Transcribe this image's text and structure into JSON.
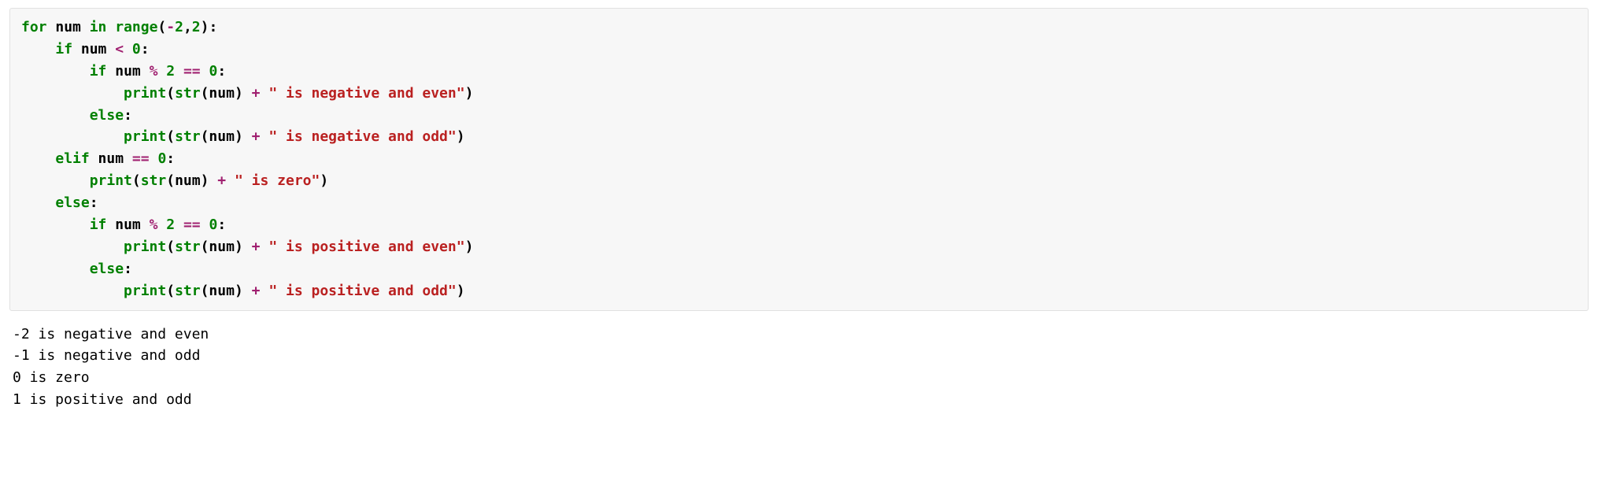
{
  "code": {
    "lines": [
      [
        {
          "cls": "k",
          "t": "for"
        },
        {
          "cls": "n",
          "t": " num "
        },
        {
          "cls": "k",
          "t": "in"
        },
        {
          "cls": "n",
          "t": " "
        },
        {
          "cls": "nb",
          "t": "range"
        },
        {
          "cls": "p",
          "t": "("
        },
        {
          "cls": "o",
          "t": "-"
        },
        {
          "cls": "mi",
          "t": "2"
        },
        {
          "cls": "p",
          "t": ","
        },
        {
          "cls": "mi",
          "t": "2"
        },
        {
          "cls": "p",
          "t": "):"
        }
      ],
      [
        {
          "cls": "n",
          "t": "    "
        },
        {
          "cls": "k",
          "t": "if"
        },
        {
          "cls": "n",
          "t": " num "
        },
        {
          "cls": "o",
          "t": "<"
        },
        {
          "cls": "n",
          "t": " "
        },
        {
          "cls": "mi",
          "t": "0"
        },
        {
          "cls": "p",
          "t": ":"
        }
      ],
      [
        {
          "cls": "n",
          "t": "        "
        },
        {
          "cls": "k",
          "t": "if"
        },
        {
          "cls": "n",
          "t": " num "
        },
        {
          "cls": "o",
          "t": "%"
        },
        {
          "cls": "n",
          "t": " "
        },
        {
          "cls": "mi",
          "t": "2"
        },
        {
          "cls": "n",
          "t": " "
        },
        {
          "cls": "o",
          "t": "=="
        },
        {
          "cls": "n",
          "t": " "
        },
        {
          "cls": "mi",
          "t": "0"
        },
        {
          "cls": "p",
          "t": ":"
        }
      ],
      [
        {
          "cls": "n",
          "t": "            "
        },
        {
          "cls": "nb",
          "t": "print"
        },
        {
          "cls": "p",
          "t": "("
        },
        {
          "cls": "nb",
          "t": "str"
        },
        {
          "cls": "p",
          "t": "(num) "
        },
        {
          "cls": "o",
          "t": "+"
        },
        {
          "cls": "p",
          "t": " "
        },
        {
          "cls": "s",
          "t": "\" is negative and even\""
        },
        {
          "cls": "p",
          "t": ")"
        }
      ],
      [
        {
          "cls": "n",
          "t": "        "
        },
        {
          "cls": "k",
          "t": "else"
        },
        {
          "cls": "p",
          "t": ":"
        }
      ],
      [
        {
          "cls": "n",
          "t": "            "
        },
        {
          "cls": "nb",
          "t": "print"
        },
        {
          "cls": "p",
          "t": "("
        },
        {
          "cls": "nb",
          "t": "str"
        },
        {
          "cls": "p",
          "t": "(num) "
        },
        {
          "cls": "o",
          "t": "+"
        },
        {
          "cls": "p",
          "t": " "
        },
        {
          "cls": "s",
          "t": "\" is negative and odd\""
        },
        {
          "cls": "p",
          "t": ")"
        }
      ],
      [
        {
          "cls": "n",
          "t": "    "
        },
        {
          "cls": "k",
          "t": "elif"
        },
        {
          "cls": "n",
          "t": " num "
        },
        {
          "cls": "o",
          "t": "=="
        },
        {
          "cls": "n",
          "t": " "
        },
        {
          "cls": "mi",
          "t": "0"
        },
        {
          "cls": "p",
          "t": ":"
        }
      ],
      [
        {
          "cls": "n",
          "t": "        "
        },
        {
          "cls": "nb",
          "t": "print"
        },
        {
          "cls": "p",
          "t": "("
        },
        {
          "cls": "nb",
          "t": "str"
        },
        {
          "cls": "p",
          "t": "(num) "
        },
        {
          "cls": "o",
          "t": "+"
        },
        {
          "cls": "p",
          "t": " "
        },
        {
          "cls": "s",
          "t": "\" is zero\""
        },
        {
          "cls": "p",
          "t": ")"
        }
      ],
      [
        {
          "cls": "n",
          "t": "    "
        },
        {
          "cls": "k",
          "t": "else"
        },
        {
          "cls": "p",
          "t": ":"
        }
      ],
      [
        {
          "cls": "n",
          "t": "        "
        },
        {
          "cls": "k",
          "t": "if"
        },
        {
          "cls": "n",
          "t": " num "
        },
        {
          "cls": "o",
          "t": "%"
        },
        {
          "cls": "n",
          "t": " "
        },
        {
          "cls": "mi",
          "t": "2"
        },
        {
          "cls": "n",
          "t": " "
        },
        {
          "cls": "o",
          "t": "=="
        },
        {
          "cls": "n",
          "t": " "
        },
        {
          "cls": "mi",
          "t": "0"
        },
        {
          "cls": "p",
          "t": ":"
        }
      ],
      [
        {
          "cls": "n",
          "t": "            "
        },
        {
          "cls": "nb",
          "t": "print"
        },
        {
          "cls": "p",
          "t": "("
        },
        {
          "cls": "nb",
          "t": "str"
        },
        {
          "cls": "p",
          "t": "(num) "
        },
        {
          "cls": "o",
          "t": "+"
        },
        {
          "cls": "p",
          "t": " "
        },
        {
          "cls": "s",
          "t": "\" is positive and even\""
        },
        {
          "cls": "p",
          "t": ")"
        }
      ],
      [
        {
          "cls": "n",
          "t": "        "
        },
        {
          "cls": "k",
          "t": "else"
        },
        {
          "cls": "p",
          "t": ":"
        }
      ],
      [
        {
          "cls": "n",
          "t": "            "
        },
        {
          "cls": "nb",
          "t": "print"
        },
        {
          "cls": "p",
          "t": "("
        },
        {
          "cls": "nb",
          "t": "str"
        },
        {
          "cls": "p",
          "t": "(num) "
        },
        {
          "cls": "o",
          "t": "+"
        },
        {
          "cls": "p",
          "t": " "
        },
        {
          "cls": "s",
          "t": "\" is positive and odd\""
        },
        {
          "cls": "p",
          "t": ")"
        }
      ]
    ]
  },
  "output": {
    "lines": [
      "-2 is negative and even",
      "-1 is negative and odd",
      "0 is zero",
      "1 is positive and odd"
    ]
  }
}
